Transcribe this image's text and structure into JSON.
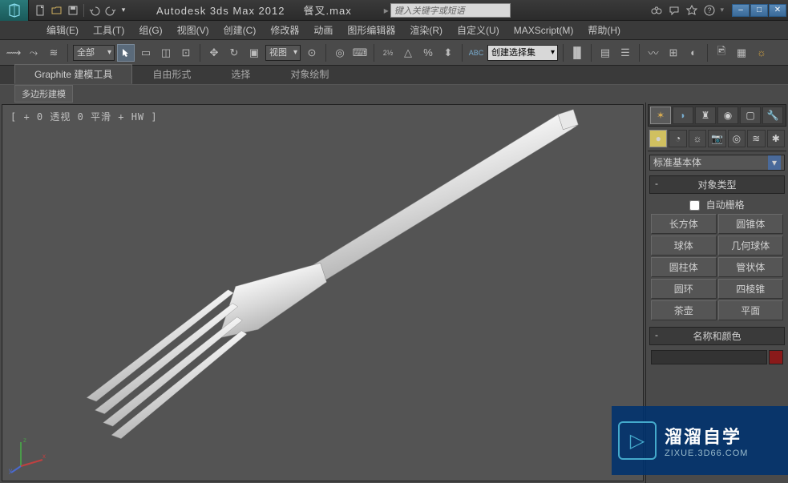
{
  "app": {
    "title": "Autodesk 3ds Max  2012",
    "filename": "餐叉.max"
  },
  "search": {
    "placeholder": "键入关键字或短语"
  },
  "menu": {
    "edit": "编辑(E)",
    "tools": "工具(T)",
    "group": "组(G)",
    "views": "视图(V)",
    "create": "创建(C)",
    "modifiers": "修改器",
    "animation": "动画",
    "grapheditors": "图形编辑器",
    "rendering": "渲染(R)",
    "customize": "自定义(U)",
    "maxscript": "MAXScript(M)",
    "help": "帮助(H)"
  },
  "toolbar": {
    "sel_filter": "全部",
    "ref_coord": "视图",
    "named_sel": "创建选择集"
  },
  "ribbon": {
    "t1": "Graphite 建模工具",
    "t2": "自由形式",
    "t3": "选择",
    "t4": "对象绘制",
    "sub": "多边形建模"
  },
  "viewport": {
    "label": "[ + 0 透视 0 平滑 + HW ]"
  },
  "cmd": {
    "category": "标准基本体",
    "rollout_objtype": "对象类型",
    "autogrid": "自动栅格",
    "objects": [
      "长方体",
      "圆锥体",
      "球体",
      "几何球体",
      "圆柱体",
      "管状体",
      "圆环",
      "四棱锥",
      "茶壶",
      "平面"
    ],
    "rollout_namecolor": "名称和颜色"
  },
  "watermark": {
    "title": "溜溜自学",
    "sub": "ZIXUE.3D66.COM"
  }
}
